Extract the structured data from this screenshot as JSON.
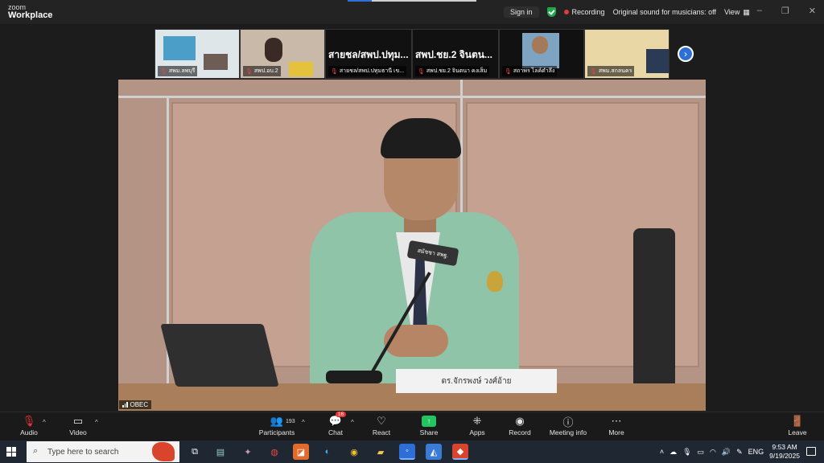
{
  "titlebar": {
    "logo_small": "zoom",
    "logo_big": "Workplace",
    "sign_in": "Sign in",
    "recording": "Recording",
    "original_sound": "Original sound for musicians: off",
    "view": "View",
    "controls": [
      "–",
      "❐",
      "✕"
    ]
  },
  "strip": {
    "tiles": [
      {
        "label": "สพม.ลพบุรี",
        "muted": true
      },
      {
        "label": "สพป.อบ.2",
        "muted": true
      },
      {
        "big_name": "สายชล/สพป.ปทุม...",
        "label": "สายชล/สพป.ปทุมธานี เข...",
        "muted": true
      },
      {
        "big_name": "สพป.ชย.2 จินตน...",
        "label": "สพป.ชย.2 จินตนา คงเส็ม",
        "muted": true
      },
      {
        "label": "สถาพร ไลค์ตำลึง",
        "muted": true
      },
      {
        "label": "สพม.สกลนคร",
        "muted": true
      }
    ],
    "next_icon": "chevron-right-icon"
  },
  "main_video": {
    "label": "OBEC",
    "mic_text": "สมัชชา สพฐ.",
    "nameplate": "ดร.จักรพงษ์ วงศ์อ้าย"
  },
  "toolbar": {
    "audio": "Audio",
    "video": "Video",
    "participants": "Participants",
    "participants_count": "193",
    "chat": "Chat",
    "chat_badge": "16",
    "react": "React",
    "share": "Share",
    "apps": "Apps",
    "record": "Record",
    "meeting_info": "Meeting info",
    "more": "More",
    "leave": "Leave"
  },
  "taskbar": {
    "search_placeholder": "Type here to search",
    "lang": "ENG",
    "time": "9:53 AM",
    "date": "9/19/2025"
  },
  "colors": {
    "share_green": "#23c55e",
    "record_red": "#e23b3b",
    "accent_blue": "#2d6fd6"
  }
}
